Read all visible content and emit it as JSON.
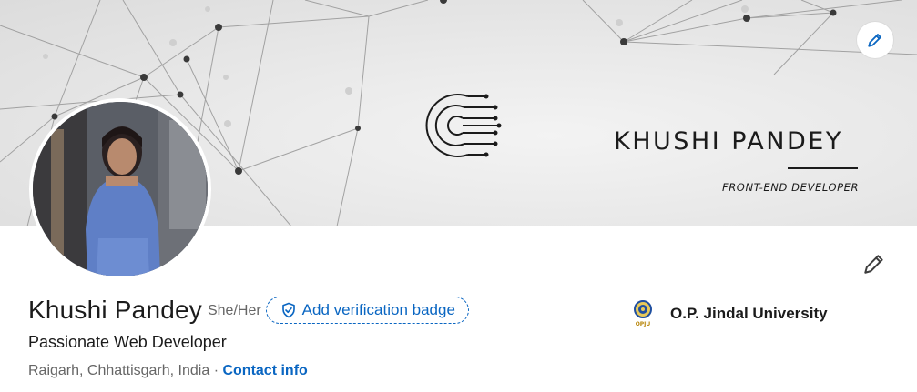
{
  "banner": {
    "name": "KHUSHI PANDEY",
    "subtitle": "FRONT-END DEVELOPER",
    "edit_icon": "pencil-icon"
  },
  "profile": {
    "name": "Khushi Pandey",
    "pronouns": "She/Her",
    "verification_label": "Add verification badge",
    "headline": "Passionate Web Developer",
    "location": "Raigarh, Chhattisgarh, India",
    "separator": "·",
    "contact_label": "Contact info",
    "edit_icon": "pencil-icon"
  },
  "education": {
    "school": "O.P. Jindal University",
    "logo_text": "OPJU"
  },
  "colors": {
    "link": "#0a66c2",
    "text_primary": "#1b1b1b",
    "text_secondary": "#666666"
  }
}
